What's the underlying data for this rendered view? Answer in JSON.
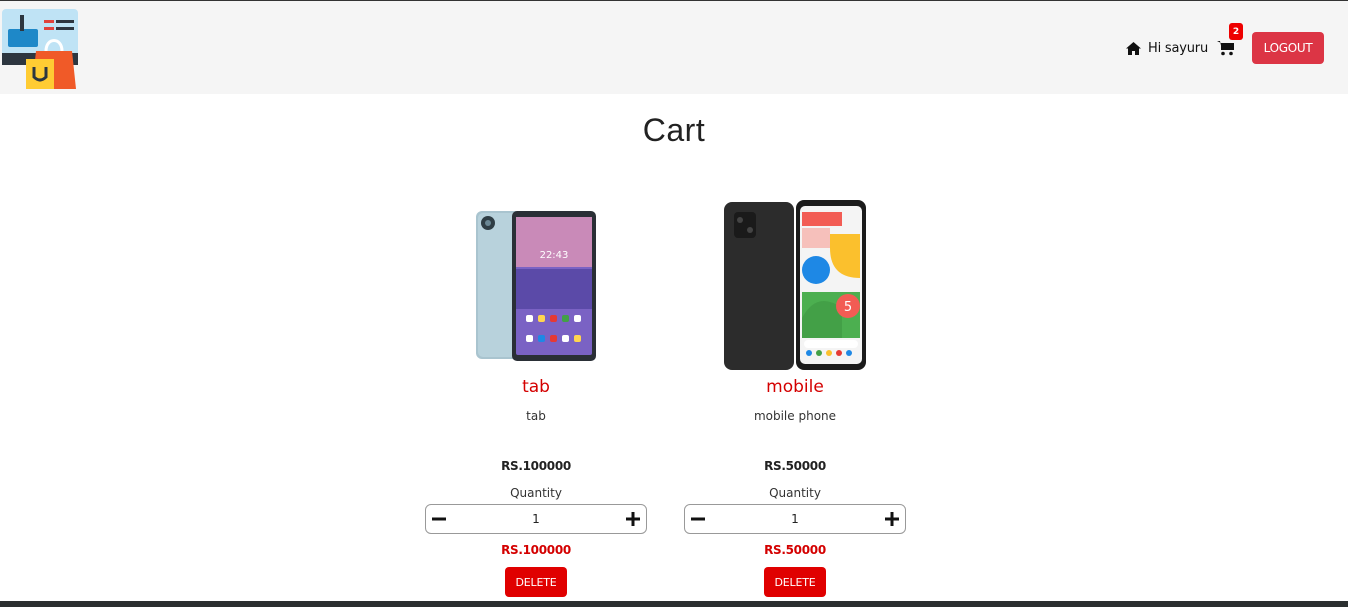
{
  "header": {
    "greeting": "Hi sayuru",
    "cart_count": "2",
    "logout_label": "LOGOUT"
  },
  "page": {
    "title": "Cart"
  },
  "items": [
    {
      "name": "tab",
      "description": "tab",
      "price": "RS.100000",
      "quantity_label": "Quantity",
      "quantity": "1",
      "subtotal": "RS.100000",
      "delete_label": "DELETE"
    },
    {
      "name": "mobile",
      "description": "mobile phone",
      "price": "RS.50000",
      "quantity_label": "Quantity",
      "quantity": "1",
      "subtotal": "RS.50000",
      "delete_label": "DELETE"
    }
  ],
  "icons": {
    "logo": "shop-logo-icon",
    "home": "home-icon",
    "cart": "cart-icon",
    "minus": "minus-icon",
    "plus": "plus-icon"
  },
  "colors": {
    "accent_red": "#d40000",
    "logout_bg": "#dc3545",
    "header_bg": "#f5f5f5"
  }
}
